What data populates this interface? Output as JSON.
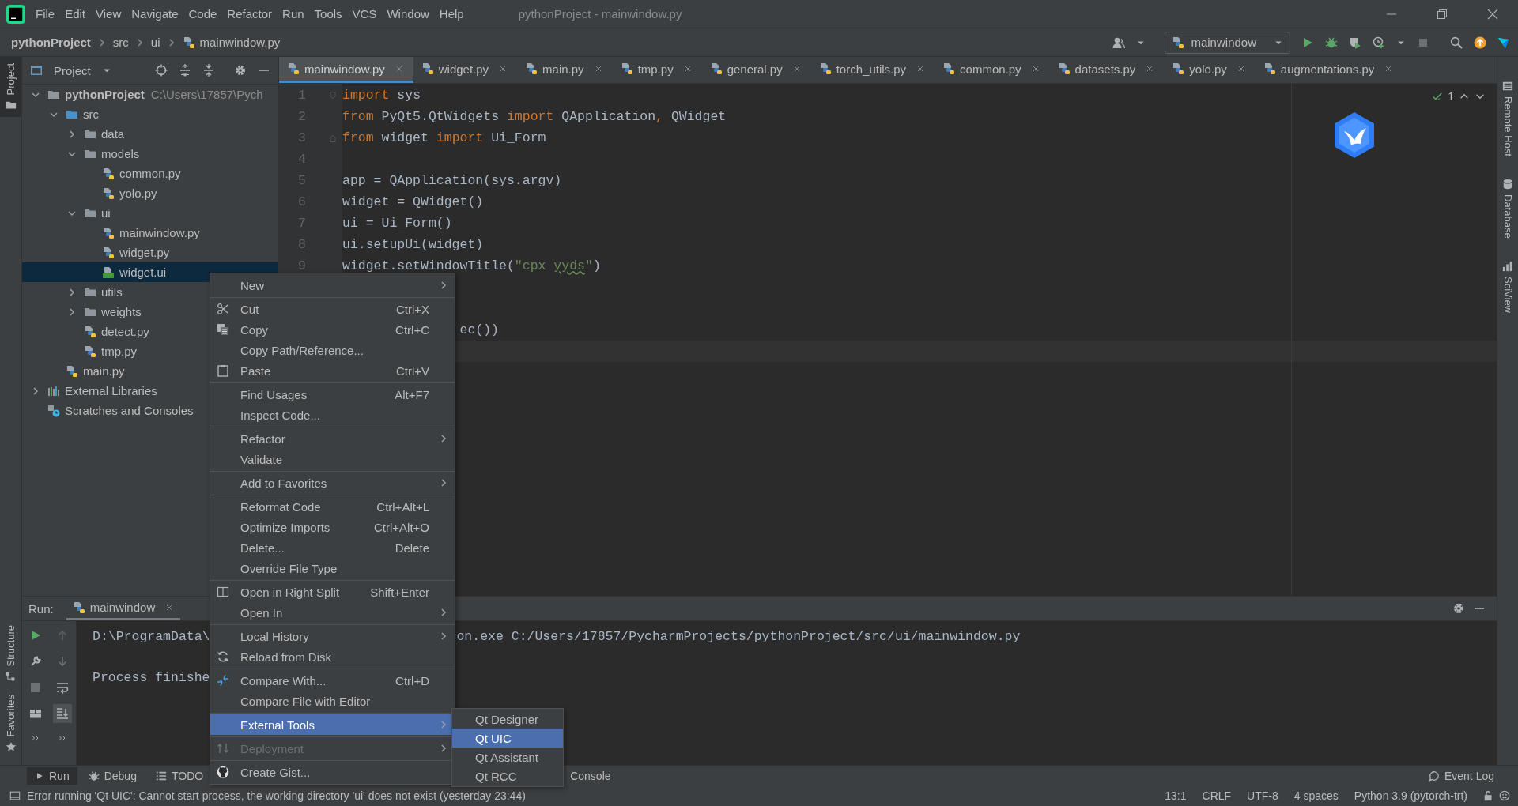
{
  "menubar": {
    "items": [
      "File",
      "Edit",
      "View",
      "Navigate",
      "Code",
      "Refactor",
      "Run",
      "Tools",
      "VCS",
      "Window",
      "Help"
    ],
    "title": "pythonProject - mainwindow.py"
  },
  "breadcrumb": [
    {
      "label": "pythonProject",
      "kind": "project"
    },
    {
      "label": "src",
      "kind": "folder"
    },
    {
      "label": "ui",
      "kind": "folder"
    },
    {
      "label": "mainwindow.py",
      "kind": "pyfile"
    }
  ],
  "run_config": {
    "label": "mainwindow"
  },
  "left_stripe": [
    {
      "label": "Project",
      "selected": true,
      "kind": "top"
    },
    {
      "label": "Structure",
      "selected": false,
      "kind": "bottom"
    },
    {
      "label": "Favorites",
      "selected": false,
      "kind": "bottom"
    }
  ],
  "right_stripe": [
    "Remote Host",
    "Database",
    "SciView"
  ],
  "project_panel": {
    "title": "Project",
    "tree": [
      {
        "label": "pythonProject",
        "path": "C:\\Users\\17857\\Pych",
        "kind": "project",
        "expanded": true,
        "selected": false,
        "children": [
          {
            "label": "src",
            "kind": "source-folder",
            "expanded": true,
            "selected": false,
            "children": [
              {
                "label": "data",
                "kind": "folder",
                "expanded": false,
                "selected": false
              },
              {
                "label": "models",
                "kind": "folder",
                "expanded": true,
                "selected": false,
                "children": [
                  {
                    "label": "common.py",
                    "kind": "pyfile",
                    "selected": false
                  },
                  {
                    "label": "yolo.py",
                    "kind": "pyfile",
                    "selected": false
                  }
                ]
              },
              {
                "label": "ui",
                "kind": "folder",
                "expanded": true,
                "selected": false,
                "children": [
                  {
                    "label": "mainwindow.py",
                    "kind": "pyfile",
                    "selected": false
                  },
                  {
                    "label": "widget.py",
                    "kind": "pyfile",
                    "selected": false
                  },
                  {
                    "label": "widget.ui",
                    "kind": "uifile",
                    "selected": true
                  }
                ]
              },
              {
                "label": "utils",
                "kind": "folder",
                "expanded": false,
                "selected": false
              },
              {
                "label": "weights",
                "kind": "folder",
                "expanded": false,
                "selected": false
              },
              {
                "label": "detect.py",
                "kind": "pyfile",
                "selected": false
              },
              {
                "label": "tmp.py",
                "kind": "pyfile",
                "selected": false
              }
            ]
          },
          {
            "label": "main.py",
            "kind": "pyfile",
            "selected": false
          }
        ]
      },
      {
        "label": "External Libraries",
        "kind": "library",
        "expanded": false,
        "selected": false
      },
      {
        "label": "Scratches and Consoles",
        "kind": "scratches",
        "selected": false
      }
    ]
  },
  "editor": {
    "tabs": [
      {
        "label": "mainwindow.py",
        "selected": true
      },
      {
        "label": "widget.py",
        "selected": false
      },
      {
        "label": "main.py",
        "selected": false
      },
      {
        "label": "tmp.py",
        "selected": false
      },
      {
        "label": "general.py",
        "selected": false
      },
      {
        "label": "torch_utils.py",
        "selected": false
      },
      {
        "label": "common.py",
        "selected": false
      },
      {
        "label": "datasets.py",
        "selected": false
      },
      {
        "label": "yolo.py",
        "selected": false
      },
      {
        "label": "augmentations.py",
        "selected": false
      }
    ],
    "inspections": "1",
    "lines": [
      {
        "kind": "normal",
        "number": "1",
        "fold_open": true,
        "tokens": [
          {
            "text": "import",
            "kind": "keyword"
          },
          {
            "text": " sys",
            "kind": "plain"
          }
        ]
      },
      {
        "kind": "normal",
        "number": "2",
        "tokens": [
          {
            "text": "from",
            "kind": "keyword"
          },
          {
            "text": " PyQt5.QtWidgets ",
            "kind": "plain"
          },
          {
            "text": "import",
            "kind": "keyword"
          },
          {
            "text": " QApplication",
            "kind": "plain"
          },
          {
            "text": ",",
            "kind": "keyword"
          },
          {
            "text": " QWidget",
            "kind": "plain"
          }
        ]
      },
      {
        "kind": "normal",
        "number": "3",
        "fold_close": true,
        "tokens": [
          {
            "text": "from",
            "kind": "keyword"
          },
          {
            "text": " widget ",
            "kind": "plain"
          },
          {
            "text": "import",
            "kind": "keyword"
          },
          {
            "text": " Ui_Form",
            "kind": "plain"
          }
        ]
      },
      {
        "kind": "normal",
        "number": "4"
      },
      {
        "kind": "normal",
        "number": "5",
        "tokens": [
          {
            "text": "app = QApplication(sys.argv)",
            "kind": "plain"
          }
        ]
      },
      {
        "kind": "normal",
        "number": "6",
        "tokens": [
          {
            "text": "widget = QWidget()",
            "kind": "plain"
          }
        ]
      },
      {
        "kind": "normal",
        "number": "7",
        "tokens": [
          {
            "text": "ui = Ui_Form()",
            "kind": "plain"
          }
        ]
      },
      {
        "kind": "normal",
        "number": "8",
        "tokens": [
          {
            "text": "ui.setupUi(widget)",
            "kind": "plain"
          }
        ]
      },
      {
        "kind": "normal",
        "number": "9",
        "tokens": [
          {
            "text": "widget.setWindowTitle(",
            "kind": "plain"
          },
          {
            "text": "\"cpx ",
            "kind": "string"
          },
          {
            "text": "yyds",
            "kind": "typo"
          },
          {
            "text": "\"",
            "kind": "string"
          },
          {
            "text": ")",
            "kind": "plain"
          }
        ]
      },
      {
        "kind": "covered"
      },
      {
        "kind": "covered"
      },
      {
        "kind": "partial",
        "tokens": [
          {
            "text": "ec())",
            "kind": "plain"
          }
        ]
      },
      {
        "kind": "current"
      }
    ]
  },
  "context_menu": {
    "groups": [
      [
        {
          "label": "New",
          "submenu": true,
          "selected": false
        }
      ],
      [
        {
          "label": "Cut",
          "shortcut": "Ctrl+X",
          "selected": false
        },
        {
          "label": "Copy",
          "shortcut": "Ctrl+C",
          "selected": false
        },
        {
          "label": "Copy Path/Reference...",
          "selected": false
        },
        {
          "label": "Paste",
          "shortcut": "Ctrl+V",
          "selected": false
        }
      ],
      [
        {
          "label": "Find Usages",
          "shortcut": "Alt+F7",
          "selected": false
        },
        {
          "label": "Inspect Code...",
          "selected": false
        }
      ],
      [
        {
          "label": "Refactor",
          "submenu": true,
          "selected": false
        },
        {
          "label": "Validate",
          "selected": false
        }
      ],
      [
        {
          "label": "Add to Favorites",
          "submenu": true,
          "selected": false
        }
      ],
      [
        {
          "label": "Reformat Code",
          "shortcut": "Ctrl+Alt+L",
          "selected": false
        },
        {
          "label": "Optimize Imports",
          "shortcut": "Ctrl+Alt+O",
          "selected": false
        },
        {
          "label": "Delete...",
          "shortcut": "Delete",
          "selected": false
        },
        {
          "label": "Override File Type",
          "selected": false
        }
      ],
      [
        {
          "label": "Open in Right Split",
          "shortcut": "Shift+Enter",
          "selected": false
        },
        {
          "label": "Open In",
          "submenu": true,
          "selected": false
        }
      ],
      [
        {
          "label": "Local History",
          "submenu": true,
          "selected": false
        },
        {
          "label": "Reload from Disk",
          "selected": false
        }
      ],
      [
        {
          "label": "Compare With...",
          "shortcut": "Ctrl+D",
          "selected": false
        },
        {
          "label": "Compare File with Editor",
          "selected": false
        }
      ],
      [
        {
          "label": "External Tools",
          "submenu": true,
          "selected": true
        }
      ],
      [
        {
          "label": "Deployment",
          "submenu": true,
          "selected": false,
          "disabled": true
        }
      ],
      [
        {
          "label": "Create Gist...",
          "selected": false
        }
      ]
    ]
  },
  "submenu": [
    {
      "label": "Qt Designer",
      "selected": false
    },
    {
      "label": "Qt UIC",
      "selected": true
    },
    {
      "label": "Qt Assistant",
      "selected": false
    },
    {
      "label": "Qt RCC",
      "selected": false
    }
  ],
  "run_panel": {
    "label": "Run:",
    "tabs": [
      {
        "label": "mainwindow",
        "selected": true
      }
    ],
    "output": [
      {
        "kind": "split",
        "left": "D:\\ProgramData\\",
        "right": "on.exe C:/Users/17857/PycharmProjects/pythonProject/src/ui/mainwindow.py"
      },
      {
        "kind": "blank"
      },
      {
        "kind": "text",
        "left": "Process finishe"
      }
    ]
  },
  "bottom_bar": {
    "tabs": [
      {
        "label": "Run",
        "selected": true
      },
      {
        "label": "Debug",
        "selected": false
      },
      {
        "label": "TODO",
        "selected": false
      }
    ],
    "covered_tabs": [
      {
        "label": "Console",
        "selected": false
      }
    ],
    "right_tabs": [
      {
        "label": "Event Log",
        "selected": false
      }
    ]
  },
  "status_bar": {
    "message": "Error running 'Qt UIC': Cannot start process, the working directory 'ui' does not exist (yesterday 23:44)",
    "widgets": [
      "13:1",
      "CRLF",
      "UTF-8",
      "4 spaces",
      "Python 3.9 (pytorch-trt)"
    ]
  }
}
